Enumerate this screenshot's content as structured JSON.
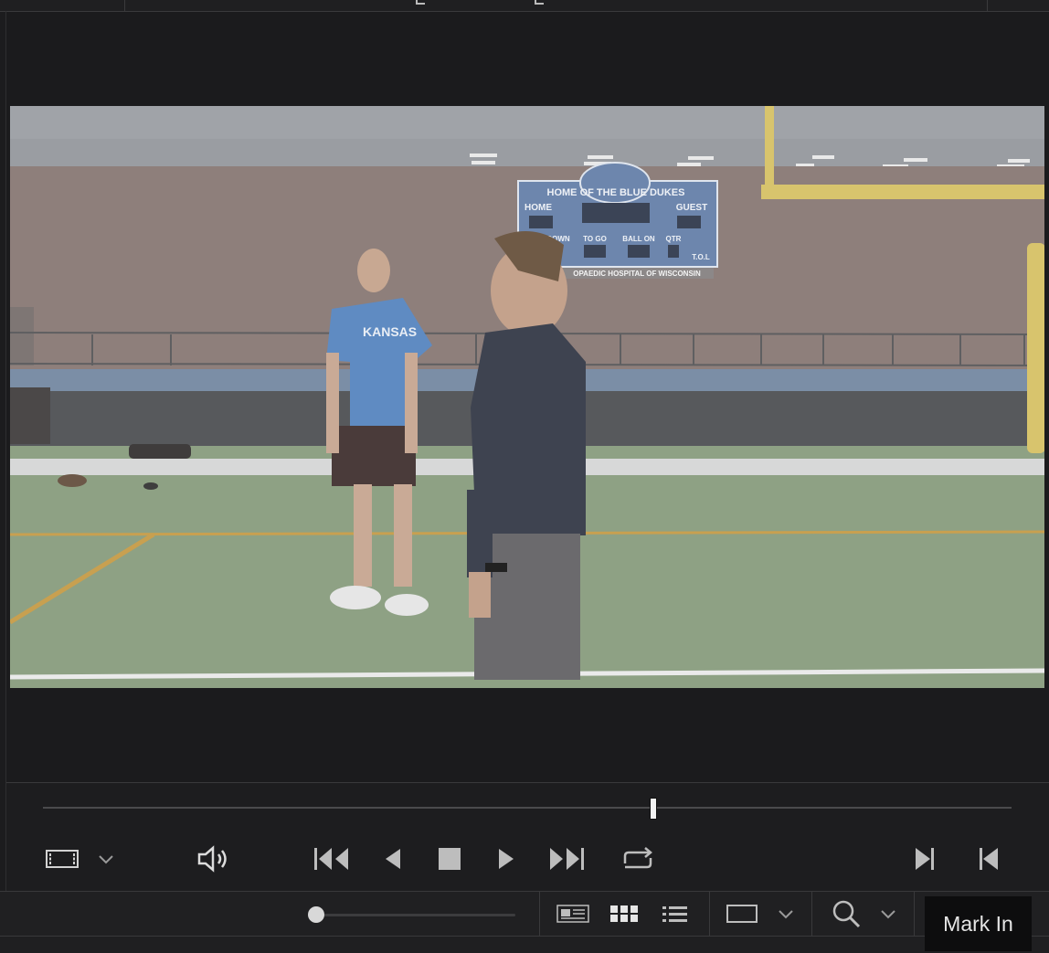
{
  "viewer": {
    "scoreboard": {
      "header": "HOME OF THE  BLUE DUKES",
      "home": "HOME",
      "guest": "GUEST",
      "down": "DOWN",
      "to_go": "TO GO",
      "ball_on": "BALL ON",
      "qtr": "QTR",
      "tol": "T.O.L",
      "sponsor": "OPAEDIC HOSPITAL OF WISCONSIN"
    },
    "shirt_text": "KANSAS"
  },
  "playback": {
    "playhead_position": 0.63,
    "icons": [
      "clip-view-icon",
      "chevron-down-icon",
      "speaker-icon",
      "skip-to-start-icon",
      "step-back-icon",
      "stop-icon",
      "play-icon",
      "skip-to-end-icon",
      "loop-icon",
      "mark-in-icon",
      "mark-out-icon"
    ]
  },
  "bottom_bar": {
    "zoom_level": 0.0,
    "icons": [
      "metadata-view-icon",
      "grid-view-icon",
      "list-view-icon",
      "aspect-rect-icon",
      "chevron-down-icon",
      "search-icon",
      "chevron-down-icon"
    ]
  },
  "tooltip": {
    "text": "Mark In"
  }
}
